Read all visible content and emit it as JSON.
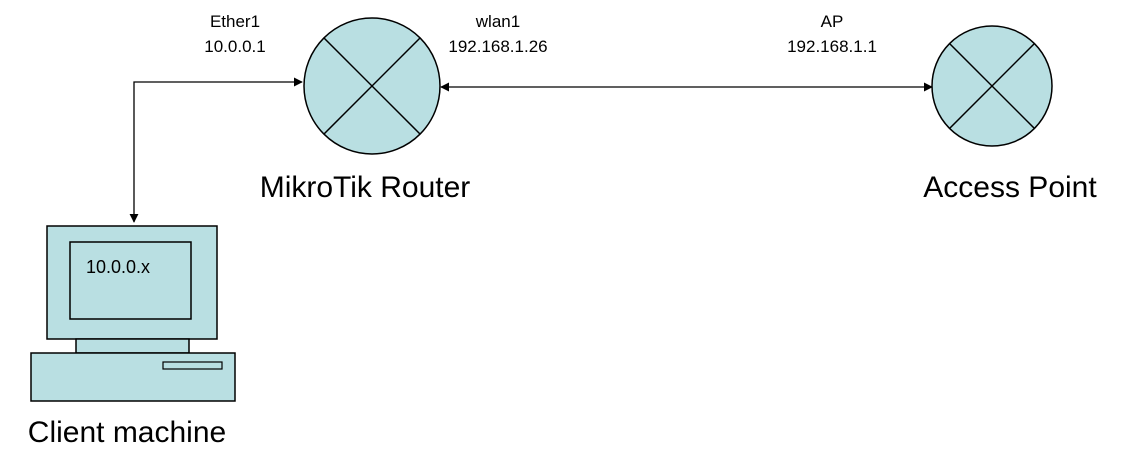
{
  "colors": {
    "node_fill": "#b9dfe2",
    "pc_fill": "#b9dfe2",
    "line": "#000000",
    "text": "#000000",
    "background": "#ffffff"
  },
  "router": {
    "name": "MikroTik Router",
    "icon": "router-icon",
    "ether_interface": "Ether1",
    "ether_ip": "10.0.0.1",
    "wlan_interface": "wlan1",
    "wlan_ip": "192.168.1.26"
  },
  "access_point": {
    "name": "Access Point",
    "icon": "access-point-icon",
    "interface": "AP",
    "ip": "192.168.1.1"
  },
  "client": {
    "name": "Client machine",
    "icon": "computer-icon",
    "screen_ip": "10.0.0.x"
  }
}
